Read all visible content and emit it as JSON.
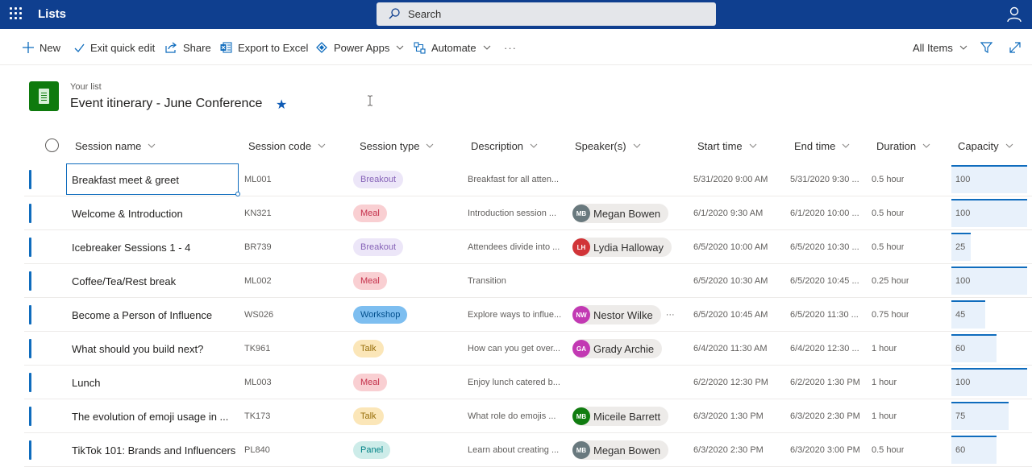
{
  "app": {
    "title": "Lists"
  },
  "search": {
    "placeholder": "Search"
  },
  "toolbar": {
    "new": "New",
    "exit_quick_edit": "Exit quick edit",
    "share": "Share",
    "export": "Export to Excel",
    "power_apps": "Power Apps",
    "automate": "Automate",
    "more": "···",
    "view": "All Items"
  },
  "list": {
    "caption": "Your list",
    "title": "Event itinerary - June Conference"
  },
  "columns": [
    "Session name",
    "Session code",
    "Session type",
    "Description",
    "Speaker(s)",
    "Start time",
    "End time",
    "Duration",
    "Capacity"
  ],
  "type_colors": {
    "Breakout": {
      "bg": "#ece6f8",
      "fg": "#8764b8"
    },
    "Meal": {
      "bg": "#f9cfd2",
      "fg": "#c4314b"
    },
    "Workshop": {
      "bg": "#7dbef0",
      "fg": "#004e8c"
    },
    "Talk": {
      "bg": "#fbe6b8",
      "fg": "#986f0b"
    },
    "Panel": {
      "bg": "#cdece9",
      "fg": "#038387"
    }
  },
  "capacity_max": 100,
  "rows": [
    {
      "name": "Breakfast meet & greet",
      "code": "ML001",
      "type": "Breakout",
      "description": "Breakfast for all atten...",
      "speaker": null,
      "start": "5/31/2020 9:00 AM",
      "end": "5/31/2020 9:30 ...",
      "duration": "0.5 hour",
      "capacity": "100"
    },
    {
      "name": "Welcome & Introduction",
      "code": "KN321",
      "type": "Meal",
      "description": "Introduction session ...",
      "speaker": {
        "initials": "MB",
        "name": "Megan Bowen",
        "color": "#69797e"
      },
      "start": "6/1/2020 9:30 AM",
      "end": "6/1/2020 10:00 ...",
      "duration": "0.5 hour",
      "capacity": "100"
    },
    {
      "name": "Icebreaker Sessions 1 - 4",
      "code": "BR739",
      "type": "Breakout",
      "description": "Attendees divide into ...",
      "speaker": {
        "initials": "LH",
        "name": "Lydia Halloway",
        "color": "#d13438"
      },
      "start": "6/5/2020 10:00 AM",
      "end": "6/5/2020 10:30 ...",
      "duration": "0.5 hour",
      "capacity": "25"
    },
    {
      "name": "Coffee/Tea/Rest break",
      "code": "ML002",
      "type": "Meal",
      "description": "Transition",
      "speaker": null,
      "start": "6/5/2020 10:30 AM",
      "end": "6/5/2020 10:45 ...",
      "duration": "0.25 hour",
      "capacity": "100"
    },
    {
      "name": "Become a Person of Influence",
      "code": "WS026",
      "type": "Workshop",
      "description": "Explore ways to influe...",
      "speaker": {
        "initials": "NW",
        "name": "Nestor Wilke",
        "color": "#c239b3",
        "more": "···"
      },
      "start": "6/5/2020 10:45 AM",
      "end": "6/5/2020 11:30 ...",
      "duration": "0.75 hour",
      "capacity": "45"
    },
    {
      "name": "What should you build next?",
      "code": "TK961",
      "type": "Talk",
      "description": "How can you get over...",
      "speaker": {
        "initials": "GA",
        "name": "Grady Archie",
        "color": "#c239b3"
      },
      "start": "6/4/2020 11:30 AM",
      "end": "6/4/2020 12:30 ...",
      "duration": "1 hour",
      "capacity": "60"
    },
    {
      "name": "Lunch",
      "code": "ML003",
      "type": "Meal",
      "description": "Enjoy lunch catered b...",
      "speaker": null,
      "start": "6/2/2020 12:30 PM",
      "end": "6/2/2020 1:30 PM",
      "duration": "1 hour",
      "capacity": "100"
    },
    {
      "name": "The evolution of emoji usage in ...",
      "code": "TK173",
      "type": "Talk",
      "description": "What role do emojis ...",
      "speaker": {
        "initials": "MB",
        "name": "Miceile Barrett",
        "color": "#107c10"
      },
      "start": "6/3/2020 1:30 PM",
      "end": "6/3/2020 2:30 PM",
      "duration": "1 hour",
      "capacity": "75"
    },
    {
      "name": "TikTok 101: Brands and Influencers",
      "code": "PL840",
      "type": "Panel",
      "description": "Learn about creating ...",
      "speaker": {
        "initials": "MB",
        "name": "Megan Bowen",
        "color": "#69797e"
      },
      "start": "6/3/2020 2:30 PM",
      "end": "6/3/2020 3:00 PM",
      "duration": "0.5 hour",
      "capacity": "60"
    }
  ]
}
